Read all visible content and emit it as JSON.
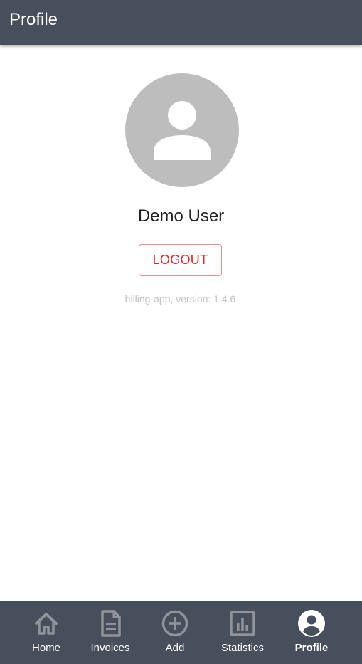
{
  "app_bar": {
    "title": "Profile"
  },
  "profile": {
    "avatar_icon": "account-icon",
    "user_name": "Demo User",
    "logout_label": "LOGOUT",
    "version_text": "billing-app, version: 1.4.6"
  },
  "bottom_nav": {
    "active": "profile",
    "items": [
      {
        "id": "home",
        "label": "Home",
        "icon": "home-icon"
      },
      {
        "id": "invoices",
        "label": "Invoices",
        "icon": "document-icon"
      },
      {
        "id": "add",
        "label": "Add",
        "icon": "add-circle-icon"
      },
      {
        "id": "statistics",
        "label": "Statistics",
        "icon": "bar-chart-icon"
      },
      {
        "id": "profile",
        "label": "Profile",
        "icon": "account-circle-icon"
      }
    ]
  },
  "colors": {
    "app_bar": "#464f5b",
    "nav_bar": "#464f5b",
    "avatar_bg": "#bdbdbd",
    "logout": "#d32f2f",
    "nav_icon_inactive": "#8f949b",
    "version_text": "#c4c4c4"
  }
}
